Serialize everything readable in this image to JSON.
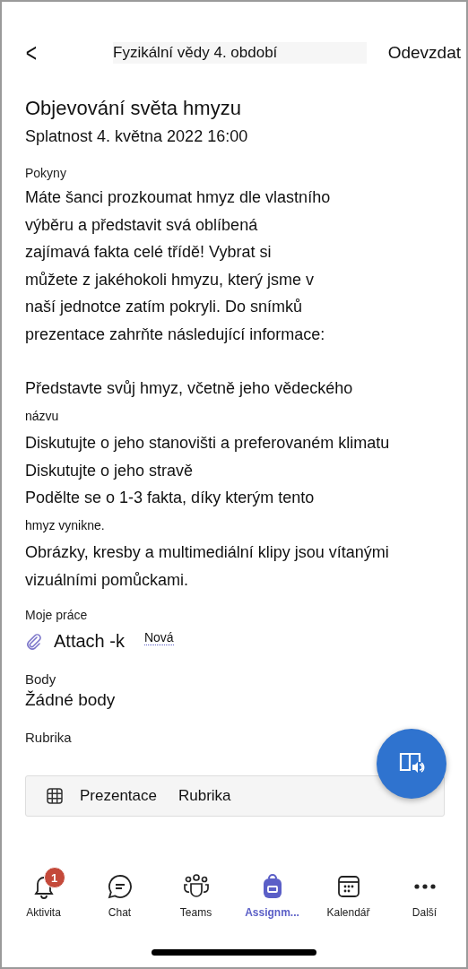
{
  "header": {
    "back": "<",
    "title": "Fyzikální vědy 4. období",
    "action": "Odevzdat"
  },
  "assignment": {
    "title": "Objevování světa hmyzu",
    "due": "Splatnost 4. května 2022 16:00"
  },
  "instructions": {
    "label": "Pokyny",
    "lines": [
      {
        "text": "Máte šanci prozkoumat hmyz dle vlastního",
        "kind": "normal"
      },
      {
        "text": "výběru a představit svá oblíbená",
        "kind": "normal"
      },
      {
        "text": "zajímavá fakta celé třídě! Vybrat si",
        "kind": "normal"
      },
      {
        "text": "můžete z jakéhokoli hmyzu, který jsme v",
        "kind": "normal"
      },
      {
        "text": "naší jednotce zatím pokryli. Do snímků",
        "kind": "normal"
      },
      {
        "text": "prezentace zahrňte následující informace:",
        "kind": "normal"
      },
      {
        "text": "Představte svůj hmyz, včetně jeho vědeckého",
        "kind": "gap"
      },
      {
        "text": "názvu",
        "kind": "small"
      },
      {
        "text": "Diskutujte o jeho stanovišti a preferovaném klimatu",
        "kind": "normal"
      },
      {
        "text": "Diskutujte o jeho stravě",
        "kind": "normal"
      },
      {
        "text": "Podělte se o 1-3 fakta, díky kterým tento",
        "kind": "normal"
      },
      {
        "text": "hmyz vynikne.",
        "kind": "small"
      },
      {
        "text": "Obrázky, kresby a multimediální klipy jsou vítanými",
        "kind": "normal"
      },
      {
        "text": "vizuálními pomůckami.",
        "kind": "normal"
      }
    ]
  },
  "my_work": {
    "label": "Moje práce",
    "attachment": "Attach -k",
    "status": "Nová"
  },
  "points": {
    "label": "Body",
    "value": "Žádné body"
  },
  "rubric": {
    "label": "Rubrika",
    "card_title": "Prezentace",
    "card_label": "Rubrika"
  },
  "nav": [
    {
      "label": "Aktivita",
      "badge": "1",
      "selected": false
    },
    {
      "label": "Chat",
      "selected": false
    },
    {
      "label": "Teams",
      "selected": false
    },
    {
      "label": "Assignm...",
      "selected": true
    },
    {
      "label": "Kalendář",
      "selected": false
    },
    {
      "label": "Další",
      "selected": false
    }
  ]
}
